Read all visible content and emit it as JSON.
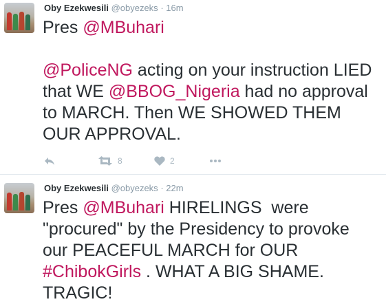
{
  "tweets": [
    {
      "name": "Oby Ezekwesili",
      "handle": "@obyezeks",
      "separator": "·",
      "time": "16m",
      "lines": [
        [
          {
            "t": "Pres "
          },
          {
            "t": "@MBuhari",
            "link": true
          }
        ],
        [],
        [
          {
            "t": "@PoliceNG",
            "link": true
          },
          {
            "t": " acting on your instruction LIED"
          }
        ],
        [
          {
            "t": "that WE "
          },
          {
            "t": "@BBOG_Nigeria",
            "link": true
          },
          {
            "t": " had no approval"
          }
        ],
        [
          {
            "t": "to MARCH. Then WE SHOWED THEM"
          }
        ],
        [
          {
            "t": "OUR APPROVAL."
          }
        ]
      ],
      "retweets": "8",
      "likes": "2"
    },
    {
      "name": "Oby Ezekwesili",
      "handle": "@obyezeks",
      "separator": "·",
      "time": "22m",
      "lines": [
        [
          {
            "t": "Pres "
          },
          {
            "t": "@MBuhari",
            "link": true
          },
          {
            "t": " HIRELINGS  were"
          }
        ],
        [
          {
            "t": "\"procured\" by the Presidency to provoke"
          }
        ],
        [
          {
            "t": "our PEACEFUL MARCH for OUR"
          }
        ],
        [
          {
            "t": "#ChibokGirls",
            "link": true
          },
          {
            "t": " . WHAT A BIG SHAME."
          }
        ],
        [
          {
            "t": "TRAGIC!"
          }
        ]
      ]
    }
  ],
  "icons": {
    "reply": "reply-icon",
    "retweet": "retweet-icon",
    "like": "heart-icon",
    "more": "more-dots-icon"
  },
  "colors": {
    "link": "#c0185e",
    "muted": "#8899a6",
    "text": "#292f33",
    "action_icon": "#aab8c2",
    "divider": "#e1e8ed"
  }
}
